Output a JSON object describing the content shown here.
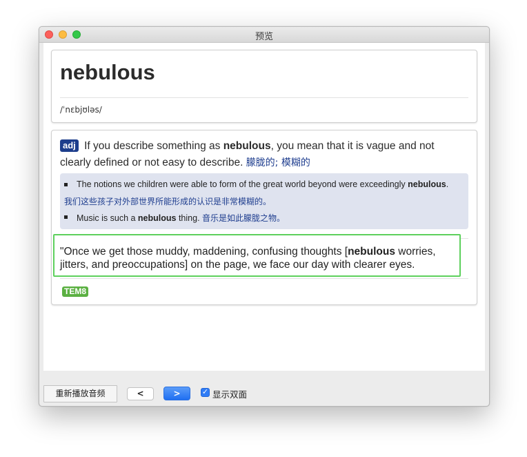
{
  "window": {
    "title": "预览"
  },
  "entry": {
    "word": "nebulous",
    "phonetic": "/ˈnɛbjʊləs/",
    "pos": "adj",
    "definition": {
      "part1": "If you describe something as ",
      "bold": "nebulous",
      "part2": ", you mean that it is vague and not clearly defined or not easy to describe.",
      "chinese": "朦胧的; 模糊的"
    },
    "examples": [
      {
        "pre": "The notions we children were able to form of the great world beyond were exceedingly ",
        "bold": "nebulous",
        "post": "."
      },
      {
        "pre": "Music is such a ",
        "bold": "nebulous",
        "post": " thing."
      }
    ],
    "examples_cn": [
      "我们这些孩子对外部世界所能形成的认识是非常模糊的。",
      "音乐是如此朦胧之物。"
    ],
    "quote": {
      "pre": "\"Once we get those muddy, maddening, confusing thoughts [",
      "bold": "nebulous",
      "post": " worries, jitters, and preoccupations] on the page, we face our day with clearer eyes."
    },
    "tag": "TEM8"
  },
  "toolbar": {
    "replay_label": "重新播放音频",
    "prev_label": "<",
    "next_label": ">",
    "show_both_label": "显示双面",
    "show_both_checked": true
  },
  "colors": {
    "pos_badge": "#1d3e8c",
    "chinese_text": "#1f3e8f",
    "example_bg": "#dfe3ef",
    "quote_border": "#5dd05c",
    "tag": "#5bb042",
    "primary_button": "#2f7cf6"
  }
}
